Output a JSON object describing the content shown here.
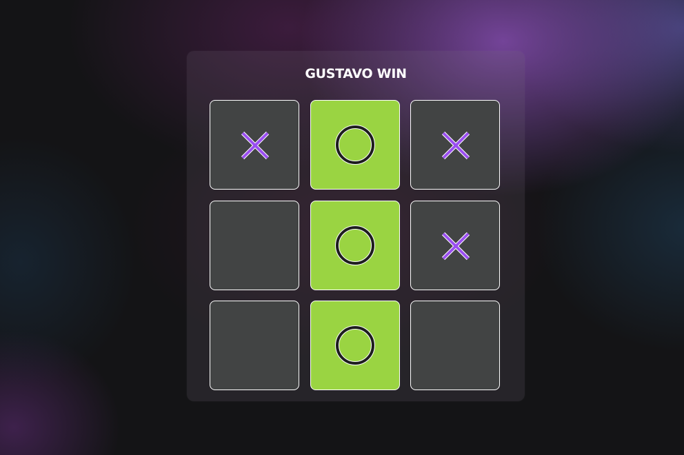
{
  "status_text": "GUSTAVO WIN",
  "board": {
    "cells": [
      "X",
      "O",
      "X",
      "",
      "O",
      "X",
      "",
      "O",
      ""
    ],
    "winning_cells": [
      1,
      4,
      7
    ]
  },
  "colors": {
    "x_mark": "#9b4ff0",
    "o_mark": "#1e1e1e",
    "cell": "#424444",
    "win_cell": "#9ad442"
  }
}
